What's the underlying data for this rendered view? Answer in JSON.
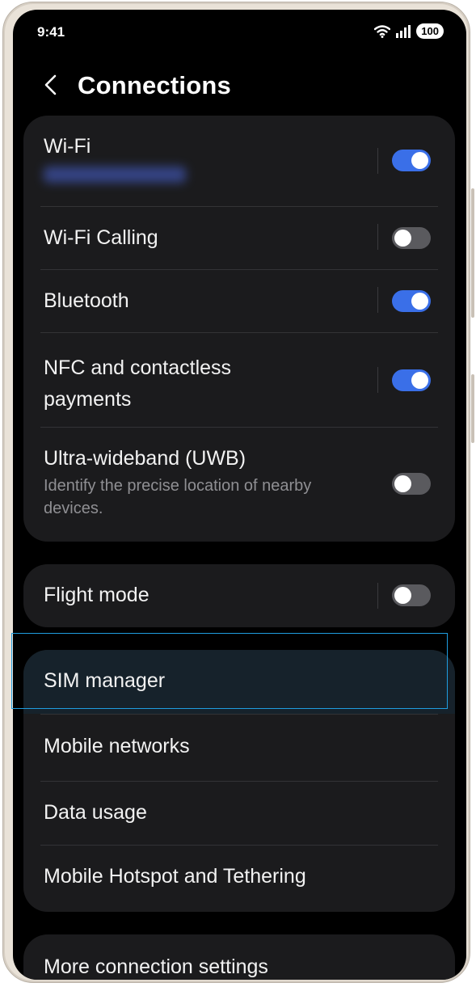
{
  "status_bar": {
    "time": "9:41",
    "battery": "100"
  },
  "header": {
    "title": "Connections"
  },
  "group_connectivity": [
    {
      "label": "Wi-Fi",
      "sub": "",
      "toggle": "on"
    },
    {
      "label": "Wi-Fi Calling",
      "toggle": "off"
    },
    {
      "label": "Bluetooth",
      "toggle": "on"
    },
    {
      "label": "NFC and contactless\npayments",
      "toggle": "on"
    },
    {
      "label": "Ultra-wideband (UWB)",
      "sub": "Identify the precise location of nearby\ndevices.",
      "toggle": "off"
    }
  ],
  "flight_mode": {
    "label": "Flight mode",
    "toggle": "off"
  },
  "group_network": [
    {
      "label": "SIM manager"
    },
    {
      "label": "Mobile networks"
    },
    {
      "label": "Data usage"
    },
    {
      "label": "Mobile Hotspot and Tethering"
    }
  ],
  "more": {
    "label": "More connection settings"
  },
  "colors": {
    "accent": "#3a6fe8",
    "card": "#1b1b1d",
    "focus": "#1f9de0"
  }
}
